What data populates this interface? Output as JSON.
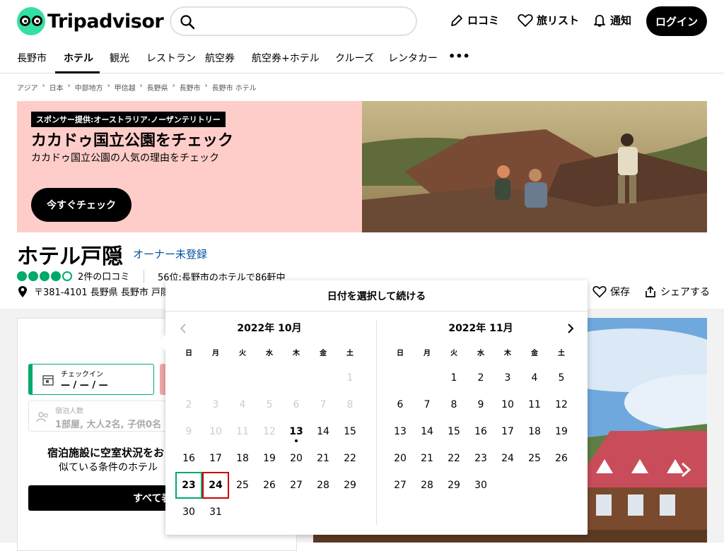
{
  "header": {
    "brand": "Tripadvisor",
    "search_placeholder": "",
    "reviews_label": "ロコミ",
    "trips_label": "旅リスト",
    "alerts_label": "通知",
    "login_label": "ログイン"
  },
  "nav": {
    "items": [
      "長野市",
      "ホテル",
      "観光",
      "レストラン",
      "航空券",
      "航空券+ホテル",
      "クルーズ",
      "レンタカー"
    ],
    "active": "ホテル",
    "more_label": "•••"
  },
  "breadcrumbs": [
    "アジア",
    "日本",
    "中部地方",
    "甲信越",
    "長野県",
    "長野市",
    "長野市 ホテル"
  ],
  "breadcrumb_sep": "›",
  "banner": {
    "sponsor": "スポンサー提供:オーストラリア·ノーザンテリトリー",
    "title": "カカドゥ国立公園をチェック",
    "subtitle": "カカドゥ国立公園の人気の理由をチェック",
    "cta": "今すぐチェック"
  },
  "hotel": {
    "name": "ホテル戸隠",
    "owner_label": "オーナー未登録",
    "rating_bubbles": 4,
    "rating_max": 5,
    "reviews_count": "2件の口コミ",
    "rank": "56位:長野市のホテルで86軒中",
    "address": "〒381-4101 長野県 長野市 戸隠",
    "save_label": "保存",
    "share_label": "シェアする"
  },
  "booking": {
    "checkin_label": "チェックイン",
    "checkin_value": "— / — / —",
    "guests_label": "宿泊人数",
    "guests_value": "1部屋, 大人2名, 子供0名",
    "availability_line1": "宿泊施設に空室状況をお",
    "availability_line2": "似ている条件のホテル",
    "see_all_label": "すべて表"
  },
  "datepicker": {
    "title": "日付を選択して続ける",
    "weekdays": [
      "日",
      "月",
      "火",
      "水",
      "木",
      "金",
      "土"
    ],
    "months": [
      {
        "title": "2022年 10月",
        "weeks": [
          [
            null,
            null,
            null,
            null,
            null,
            null,
            "1"
          ],
          [
            "2",
            "3",
            "4",
            "5",
            "6",
            "7",
            "8"
          ],
          [
            "9",
            "10",
            "11",
            "12",
            "13",
            "14",
            "15"
          ],
          [
            "16",
            "17",
            "18",
            "19",
            "20",
            "21",
            "22"
          ],
          [
            "23",
            "24",
            "25",
            "26",
            "27",
            "28",
            "29"
          ],
          [
            "30",
            "31",
            null,
            null,
            null,
            null,
            null
          ]
        ],
        "disabled_through": 12,
        "today": 13,
        "checkin": 23,
        "checkout": 24
      },
      {
        "title": "2022年 11月",
        "weeks": [
          [
            null,
            null,
            "1",
            "2",
            "3",
            "4",
            "5"
          ],
          [
            "6",
            "7",
            "8",
            "9",
            "10",
            "11",
            "12"
          ],
          [
            "13",
            "14",
            "15",
            "16",
            "17",
            "18",
            "19"
          ],
          [
            "20",
            "21",
            "22",
            "23",
            "24",
            "25",
            "26"
          ],
          [
            "27",
            "28",
            "29",
            "30",
            null,
            null,
            null
          ]
        ],
        "disabled_through": 0,
        "today": null,
        "checkin": null,
        "checkout": null
      }
    ]
  },
  "colors": {
    "brand_green": "#34e0a1",
    "rating_green": "#00aa6c",
    "banner_pink": "#ffcdc9",
    "link_blue": "#004f9e",
    "checkout_red": "#cc0000"
  }
}
